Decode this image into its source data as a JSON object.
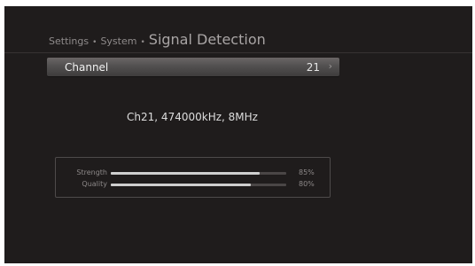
{
  "breadcrumb": {
    "items": [
      "Settings",
      "System"
    ],
    "separator": "•",
    "current": "Signal Detection"
  },
  "channel": {
    "label": "Channel",
    "value": "21",
    "arrow": "›"
  },
  "info": {
    "text": "Ch21, 474000kHz, 8MHz"
  },
  "signal": {
    "strength": {
      "label": "Strength",
      "percent": 85,
      "text": "85%"
    },
    "quality": {
      "label": "Quality",
      "percent": 80,
      "text": "80%"
    }
  }
}
